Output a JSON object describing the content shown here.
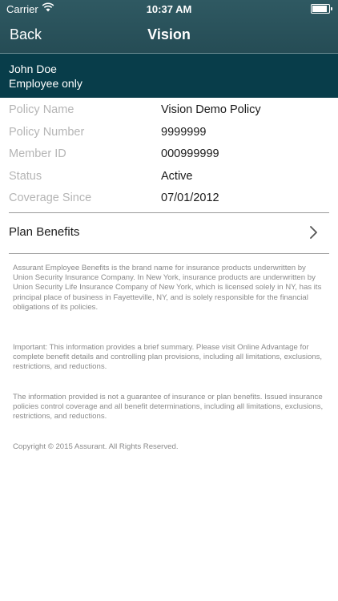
{
  "status_bar": {
    "carrier": "Carrier",
    "time": "10:37 AM"
  },
  "nav": {
    "back_label": "Back",
    "title": "Vision"
  },
  "member": {
    "name": "John Doe",
    "coverage_tier": "Employee only"
  },
  "policy": {
    "rows": [
      {
        "label": "Policy Name",
        "value": "Vision Demo Policy"
      },
      {
        "label": "Policy Number",
        "value": "9999999"
      },
      {
        "label": "Member ID",
        "value": "000999999"
      },
      {
        "label": "Status",
        "value": "Active"
      },
      {
        "label": "Coverage Since",
        "value": "07/01/2012"
      }
    ]
  },
  "plan_benefits": {
    "label": "Plan Benefits"
  },
  "disclaimers": {
    "brand": "Assurant Employee Benefits is the brand name for insurance products underwritten by Union Security Insurance Company. In New York, insurance products are underwritten by Union Security Life Insurance Company of New York, which is licensed solely in NY, has its principal place of business in Fayetteville, NY, and is solely responsible for the financial obligations of its policies.",
    "important": "Important: This information provides a brief summary.  Please visit Online Advantage for complete benefit details and controlling plan provisions, including all limitations, exclusions, restrictions, and reductions.",
    "guarantee": "The information provided is not a guarantee of insurance or plan benefits. Issued insurance policies control coverage and all benefit determinations, including all limitations, exclusions, restrictions, and reductions.",
    "copyright": "Copyright © 2015 Assurant. All Rights Reserved."
  },
  "icons": {
    "wifi": "wifi-icon",
    "battery": "battery-icon",
    "chevron": "chevron-right-icon"
  },
  "colors": {
    "nav_bar": "#2a525b",
    "member_band": "#083d4a",
    "label_text": "#b5b5b5",
    "disclaimer_text": "#8a8a8a"
  }
}
